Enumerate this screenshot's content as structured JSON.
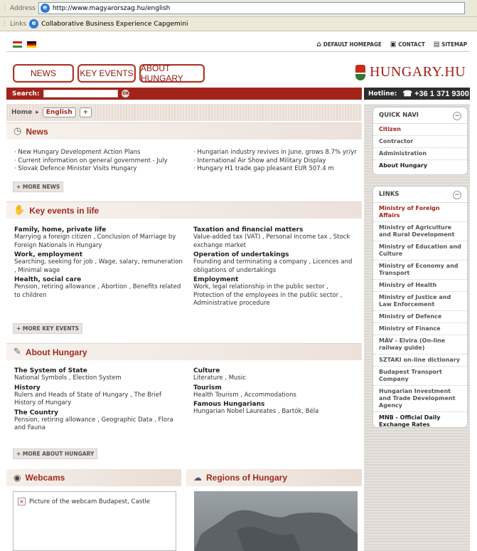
{
  "browser": {
    "address_label": "Address",
    "url": "http://www.magyarorszag.hu/english",
    "links_label": "Links",
    "links_item": "Collaborative Business Experience Capgemini"
  },
  "util": {
    "home": "DEFAULT HOMEPAGE",
    "contact": "CONTACT",
    "sitemap": "SITEMAP"
  },
  "nav": [
    "NEWS",
    "KEY EVENTS",
    "ABOUT HUNGARY"
  ],
  "logo": "HUNGARY.HU",
  "search": {
    "label": "Search:",
    "go": "OK"
  },
  "hotline": {
    "label": "Hotline:",
    "number": "+36 1 371 9300"
  },
  "breadcrumb": {
    "home": "Home",
    "lang": "English",
    "plus": "+"
  },
  "news": {
    "title": "News",
    "left": [
      "· New Hungary Development Action Plans",
      "· Current information on general government - July",
      "· Slovak Defence Minister Visits Hungary"
    ],
    "right": [
      "· Hungarian industry revives in June, grows 8.7% yr/yr",
      "· International Air Show and Military Display",
      "· Hungary H1 trade gap pleasant EUR 507.4 m"
    ],
    "more": "+ MORE NEWS"
  },
  "events": {
    "title": "Key events in life",
    "left": [
      {
        "h": "Family, home, private life",
        "t": "Marrying a foreign citizen , Conclusion of Marriage by Foreign Nationals in Hungary"
      },
      {
        "h": "Work, employment",
        "t": "Searching, seeking for job , Wage, salary, remuneration , Minimal wage"
      },
      {
        "h": "Health, social care",
        "t": "Pension, retiring allowance , Abortion , Benefits related to children"
      }
    ],
    "right": [
      {
        "h": "Taxation and financial matters",
        "t": "Value-added tax (VAT) , Personal income tax , Stock exchange market"
      },
      {
        "h": "Operation of undertakings",
        "t": "Founding and terminating a company , Licences and obligations of undertakings"
      },
      {
        "h": "Employment",
        "t": "Work, legal relationship in the public sector , Protection of the employees in the public sector , Administrative procedure"
      }
    ],
    "more": "+ MORE KEY EVENTS"
  },
  "about": {
    "title": "About Hungary",
    "left": [
      {
        "h": "The System of State",
        "t": "National Symbols , Election System"
      },
      {
        "h": "History",
        "t": "Rulers and Heads of State of Hungary , The Brief History of Hungary"
      },
      {
        "h": "The Country",
        "t": "Pension, retiring allowance , Geographic Data , Flora and Fauna"
      }
    ],
    "right": [
      {
        "h": "Culture",
        "t": "Literature , Music"
      },
      {
        "h": "Tourism",
        "t": "Health Tourism , Accommodations"
      },
      {
        "h": "Famous Hungarians",
        "t": "Hungarian Nobel Laureates , Bartók, Béla"
      }
    ],
    "more": "+ MORE ABOUT HUNGARY"
  },
  "quicknavi": {
    "title": "QUICK NAVI",
    "items": [
      "Citizen",
      "Contractor",
      "Administration",
      "About Hungary"
    ]
  },
  "links": {
    "title": "LINKS",
    "items": [
      "Ministry of Foreign Affairs",
      "Ministry of Agriculture and Rural Development",
      "Ministry of Education and Culture",
      "Ministry of Economy and Transport",
      "Ministry of Health",
      "Ministry of Justice and Law Enforcement",
      "Ministry of Defence",
      "Ministry of Finance",
      "MÁV - Elvira (On-line railway guide)",
      "SZTAKI on-line dictionary",
      "Budapest Transport Company",
      "Hungarian Investment and Trade Development Agency",
      "MNB - Official Daily Exchange Rates"
    ]
  },
  "webcams": {
    "title": "Webcams",
    "alt": "Picture of the webcam Budapest, Castle"
  },
  "regions": {
    "title": "Regions of Hungary"
  }
}
